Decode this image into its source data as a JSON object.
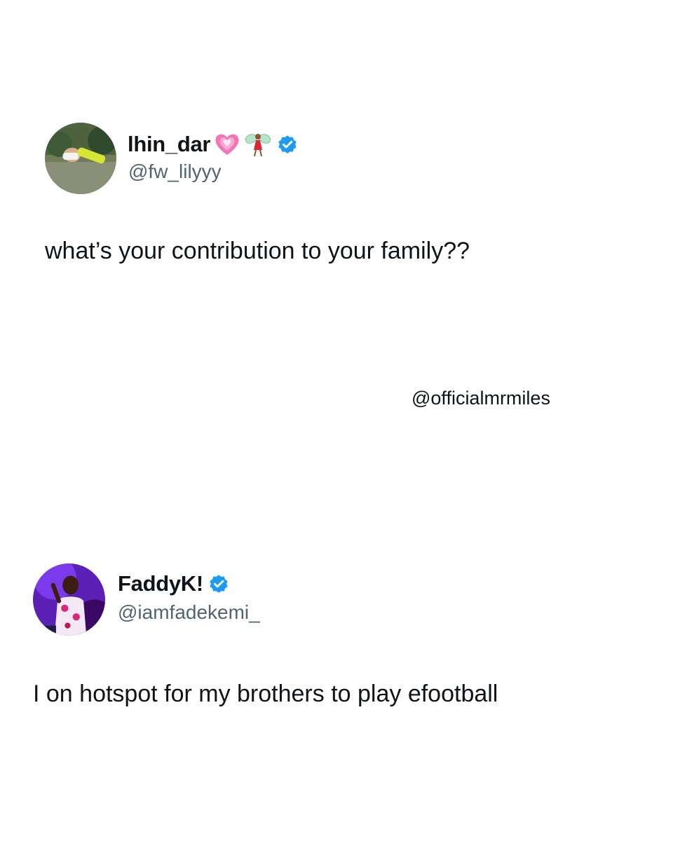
{
  "tweets": [
    {
      "display_name": "lhin_dar",
      "handle": "@fw_lilyyy",
      "text": "what’s your contribution to your family??",
      "emojis": [
        "growing-heart-icon",
        "fairy-icon"
      ],
      "verified": true,
      "verified_badge_color": "#1d9bf0"
    },
    {
      "display_name": "FaddyK!",
      "handle": "@iamfadekemi_",
      "text": "I on hotspot for my brothers to play efootball",
      "emojis": [],
      "verified": true,
      "verified_badge_color": "#1d9bf0"
    }
  ],
  "watermark": "@officialmrmiles",
  "colors": {
    "background": "#ffffff",
    "primary_text": "#0f1419",
    "secondary_text": "#536471",
    "verified_blue": "#1d9bf0"
  }
}
